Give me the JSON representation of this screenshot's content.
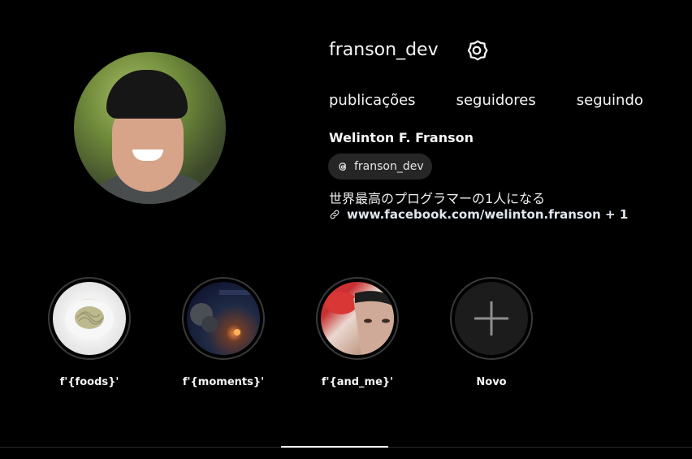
{
  "profile": {
    "username": "franson_dev",
    "full_name": "Welinton F. Franson",
    "threads_handle": "franson_dev",
    "bio": "世界最高のプログラマーの1人になる",
    "link_text": "www.facebook.com/welinton.franson + 1",
    "settings_icon": "gear-icon",
    "threads_icon": "threads-icon",
    "link_icon": "link-icon"
  },
  "stats": [
    {
      "label": "publicações"
    },
    {
      "label": "seguidores"
    },
    {
      "label": "seguindo"
    }
  ],
  "highlights": [
    {
      "label": "f'{foods}'",
      "image": "plate-of-spaghetti"
    },
    {
      "label": "f'{moments}'",
      "image": "dark-scene-with-fire"
    },
    {
      "label": "f'{and_me}'",
      "image": "face-with-red-glove"
    },
    {
      "label": "Novo",
      "icon": "plus-icon"
    }
  ],
  "colors": {
    "background": "#000000",
    "text": "#f5f5f5",
    "chip": "#262626",
    "ring": "#3a3a3a"
  }
}
